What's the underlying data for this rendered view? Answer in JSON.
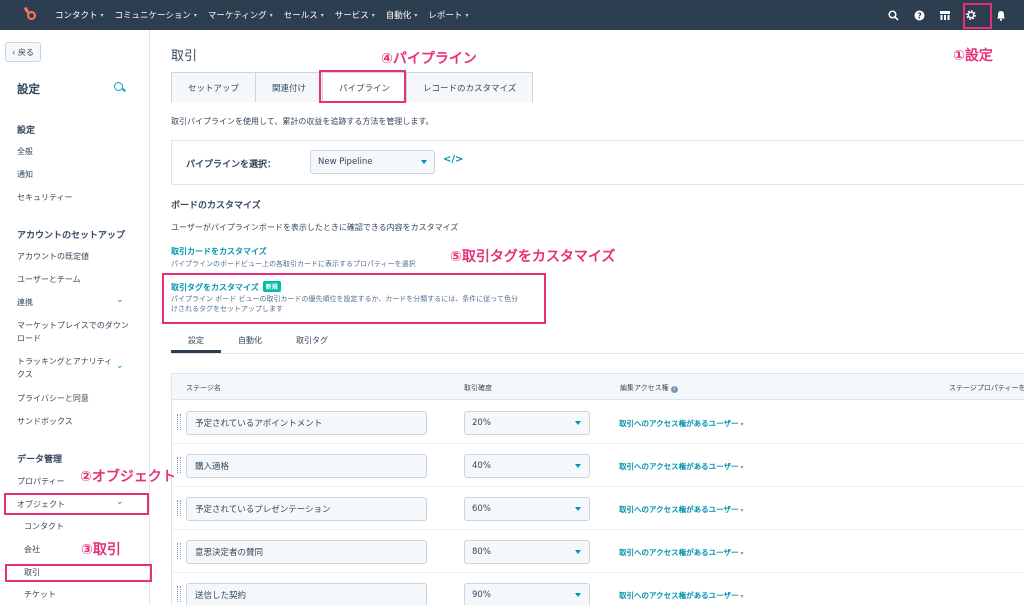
{
  "topnav": {
    "items": [
      "コンタクト",
      "コミュニケーション",
      "マーケティング",
      "セールス",
      "サービス",
      "自動化",
      "レポート"
    ],
    "icons": [
      "search-icon",
      "help-icon",
      "marketplace-icon",
      "gear-icon",
      "bell-icon"
    ]
  },
  "sidebar": {
    "back": "‹ 戻る",
    "title": "設定",
    "sections": {
      "settings": "設定",
      "account_setup": "アカウントのセットアップ",
      "data_management": "データ管理"
    },
    "items": {
      "general": "全般",
      "notifications": "通知",
      "security": "セキュリティー",
      "defaults": "アカウントの既定値",
      "users_teams": "ユーザーとチーム",
      "integrations": "連携",
      "marketplace": "マーケットプレイスでのダウンロード",
      "tracking": "トラッキングとアナリティクス",
      "privacy": "プライバシーと同意",
      "sandbox": "サンドボックス",
      "properties": "プロパティー",
      "objects": "オブジェクト",
      "contacts": "コンタクト",
      "companies": "会社",
      "deals": "取引",
      "tickets": "チケット"
    }
  },
  "main": {
    "title": "取引",
    "tabs": [
      "セットアップ",
      "関連付け",
      "パイプライン",
      "レコードのカスタマイズ"
    ],
    "description": "取引パイプラインを使用して、累計の収益を追跡する方法を管理します。",
    "pipeline_label": "パイプラインを選択：",
    "pipeline_value": "New Pipeline",
    "board_title": "ボードのカスタマイズ",
    "board_desc": "ユーザーがパイプラインボードを表示したときに確認できる内容をカスタマイズ",
    "card_link": "取引カードをカスタマイズ",
    "card_desc": "パイプラインのボードビュー上の各取引カードに表示するプロパティーを選択",
    "tag_link": "取引タグをカスタマイズ",
    "tag_badge": "新規",
    "tag_desc_line1": "パイプライン ボード ビューの取引カードの優先順位を設定するか、カードを分類するには、条件に従って色分",
    "tag_desc_line2": "けされるタグをセットアップします",
    "subtabs": [
      "設定",
      "自動化",
      "取引タグ"
    ],
    "table_headers": {
      "stage": "ステージ名",
      "probability": "取引確度",
      "access": "編集アクセス権",
      "stage_props": "ステージプロパティーを"
    },
    "rows": [
      {
        "stage": "予定されているアポイントメント",
        "probability": "20%",
        "access": "取引へのアクセス権があるユーザー"
      },
      {
        "stage": "購入適格",
        "probability": "40%",
        "access": "取引へのアクセス権があるユーザー"
      },
      {
        "stage": "予定されているプレゼンテーション",
        "probability": "60%",
        "access": "取引へのアクセス権があるユーザー"
      },
      {
        "stage": "意思決定者の賛同",
        "probability": "80%",
        "access": "取引へのアクセス権があるユーザー"
      },
      {
        "stage": "送信した契約",
        "probability": "90%",
        "access": "取引へのアクセス権があるユーザー"
      }
    ]
  },
  "annotations": {
    "settings": "①設定",
    "objects": "②オブジェクト",
    "deals": "③取引",
    "pipeline": "④パイプライン",
    "tags": "⑤取引タグをカスタマイズ"
  },
  "colors": {
    "nav_bg": "#2d3e50",
    "accent": "#0091ae",
    "annotation": "#e6317a",
    "badge": "#00bda5"
  }
}
